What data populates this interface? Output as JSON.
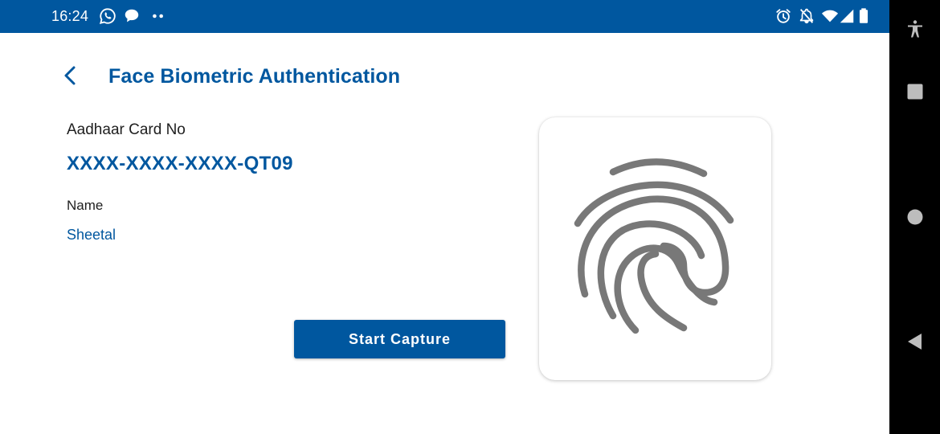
{
  "status_bar": {
    "time": "16:24",
    "left_icons": [
      "whatsapp-icon",
      "chat-bubble-icon",
      "more-dots-icon"
    ],
    "right_icons": [
      "alarm-icon",
      "notifications-off-icon",
      "wifi-icon",
      "signal-icon",
      "battery-icon"
    ],
    "background_color": "#00579f"
  },
  "header": {
    "title": "Face Biometric Authentication",
    "back_icon": "chevron-left-icon"
  },
  "details": {
    "aadhaar_label": "Aadhaar Card No",
    "aadhaar_value": "XXXX-XXXX-XXXX-QT09",
    "name_label": "Name",
    "name_value": "Sheetal"
  },
  "actions": {
    "start_capture_label": "Start Capture"
  },
  "biometric_card": {
    "icon": "fingerprint-icon"
  },
  "nav_bar": {
    "buttons": [
      "accessibility-icon",
      "recents-icon",
      "home-icon",
      "back-icon"
    ]
  },
  "colors": {
    "primary": "#00579f",
    "fingerprint": "#787878",
    "nav_background": "#000000"
  }
}
